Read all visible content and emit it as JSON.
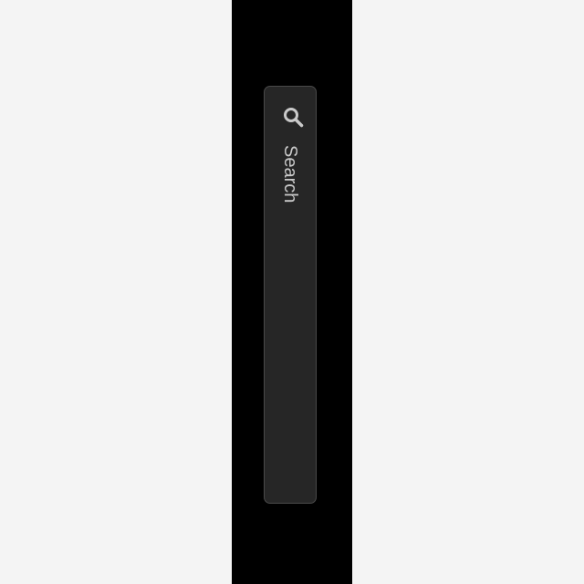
{
  "search": {
    "placeholder": "Search",
    "icon": "search-icon",
    "colors": {
      "field_background": "#262626",
      "field_border": "#4a4a4a",
      "text": "#c9c9c9"
    }
  },
  "layout_colors": {
    "page_background": "#f4f4f4",
    "center_strip": "#000000"
  }
}
